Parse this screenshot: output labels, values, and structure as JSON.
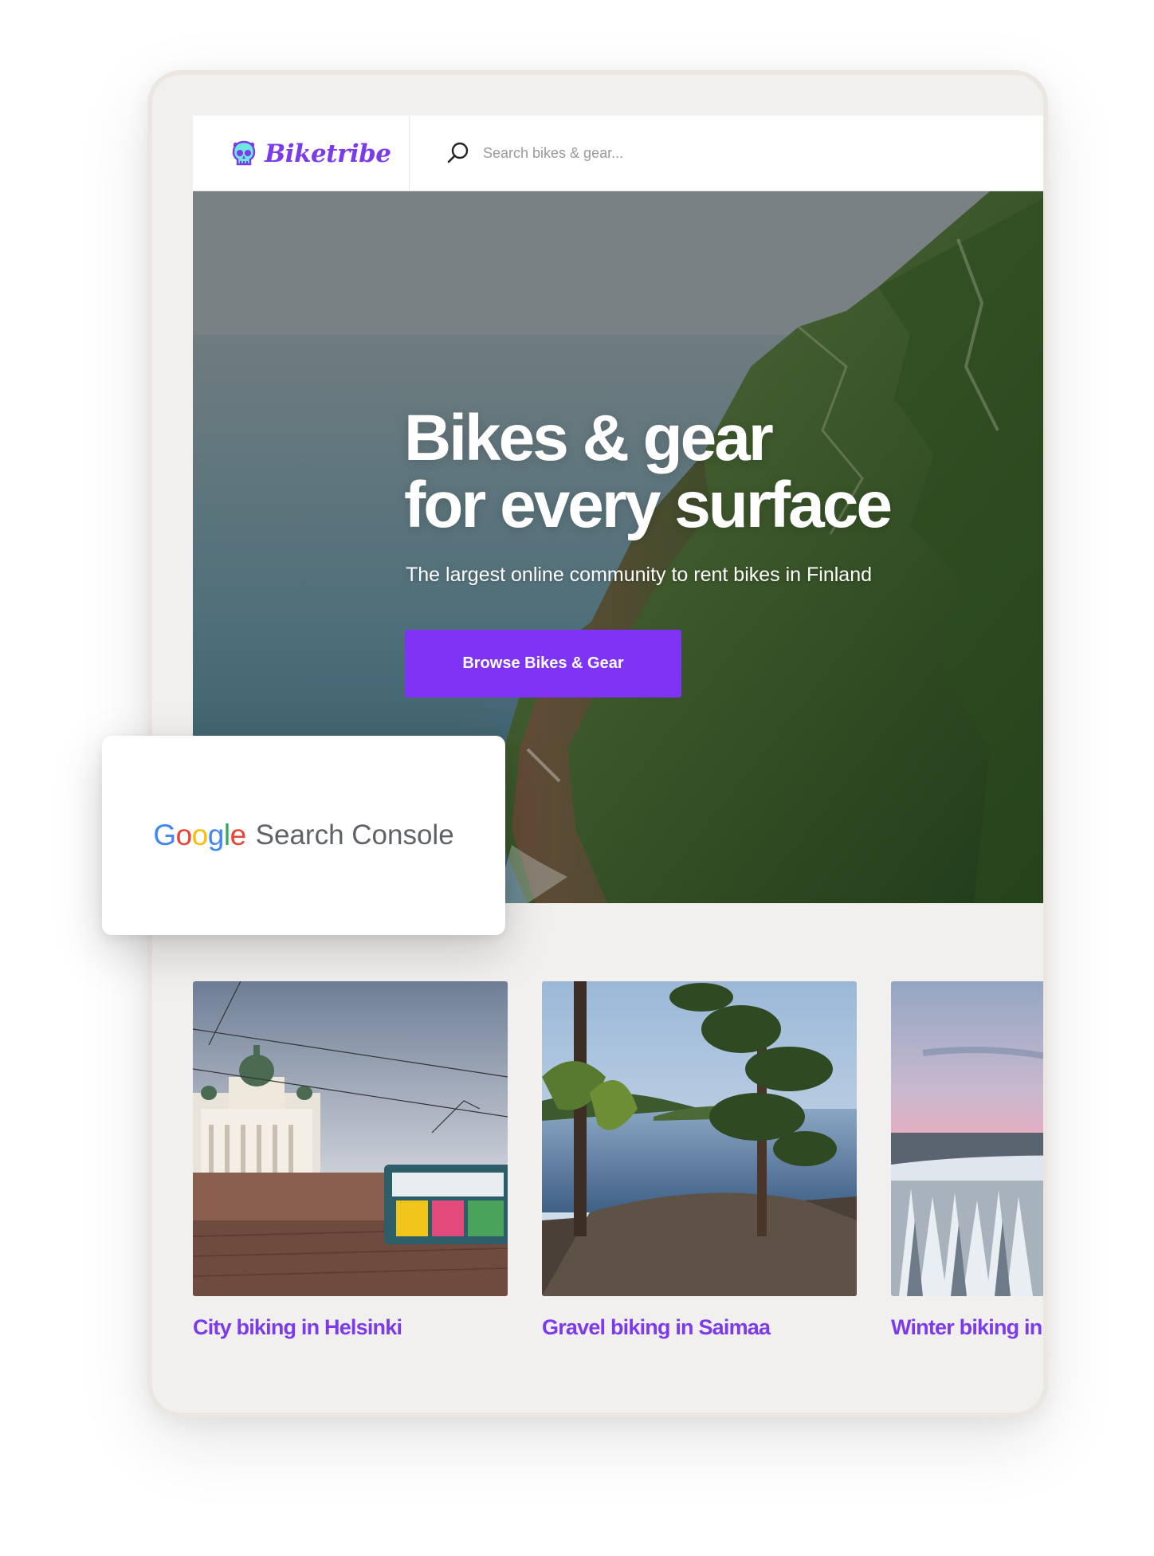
{
  "brand": {
    "name": "Biketribe",
    "logo_icon": "skull-icon",
    "accent_color": "#7c3aed"
  },
  "search": {
    "placeholder": "Search bikes & gear..."
  },
  "hero": {
    "title_line1": "Bikes & gear",
    "title_line2": "for every surface",
    "subtitle": "The largest online community to rent bikes in Finland",
    "cta_label": "Browse Bikes & Gear",
    "cta_color": "#7e33f5"
  },
  "cards": [
    {
      "title": "City biking in Helsinki"
    },
    {
      "title": "Gravel biking in Saimaa"
    },
    {
      "title": "Winter biking in Lapland"
    }
  ],
  "overlay": {
    "google_letters": [
      "G",
      "o",
      "o",
      "g",
      "l",
      "e"
    ],
    "product": "Search Console",
    "google_colors": [
      "#4285F4",
      "#EA4335",
      "#FBBC05",
      "#4285F4",
      "#34A853",
      "#EA4335"
    ]
  }
}
